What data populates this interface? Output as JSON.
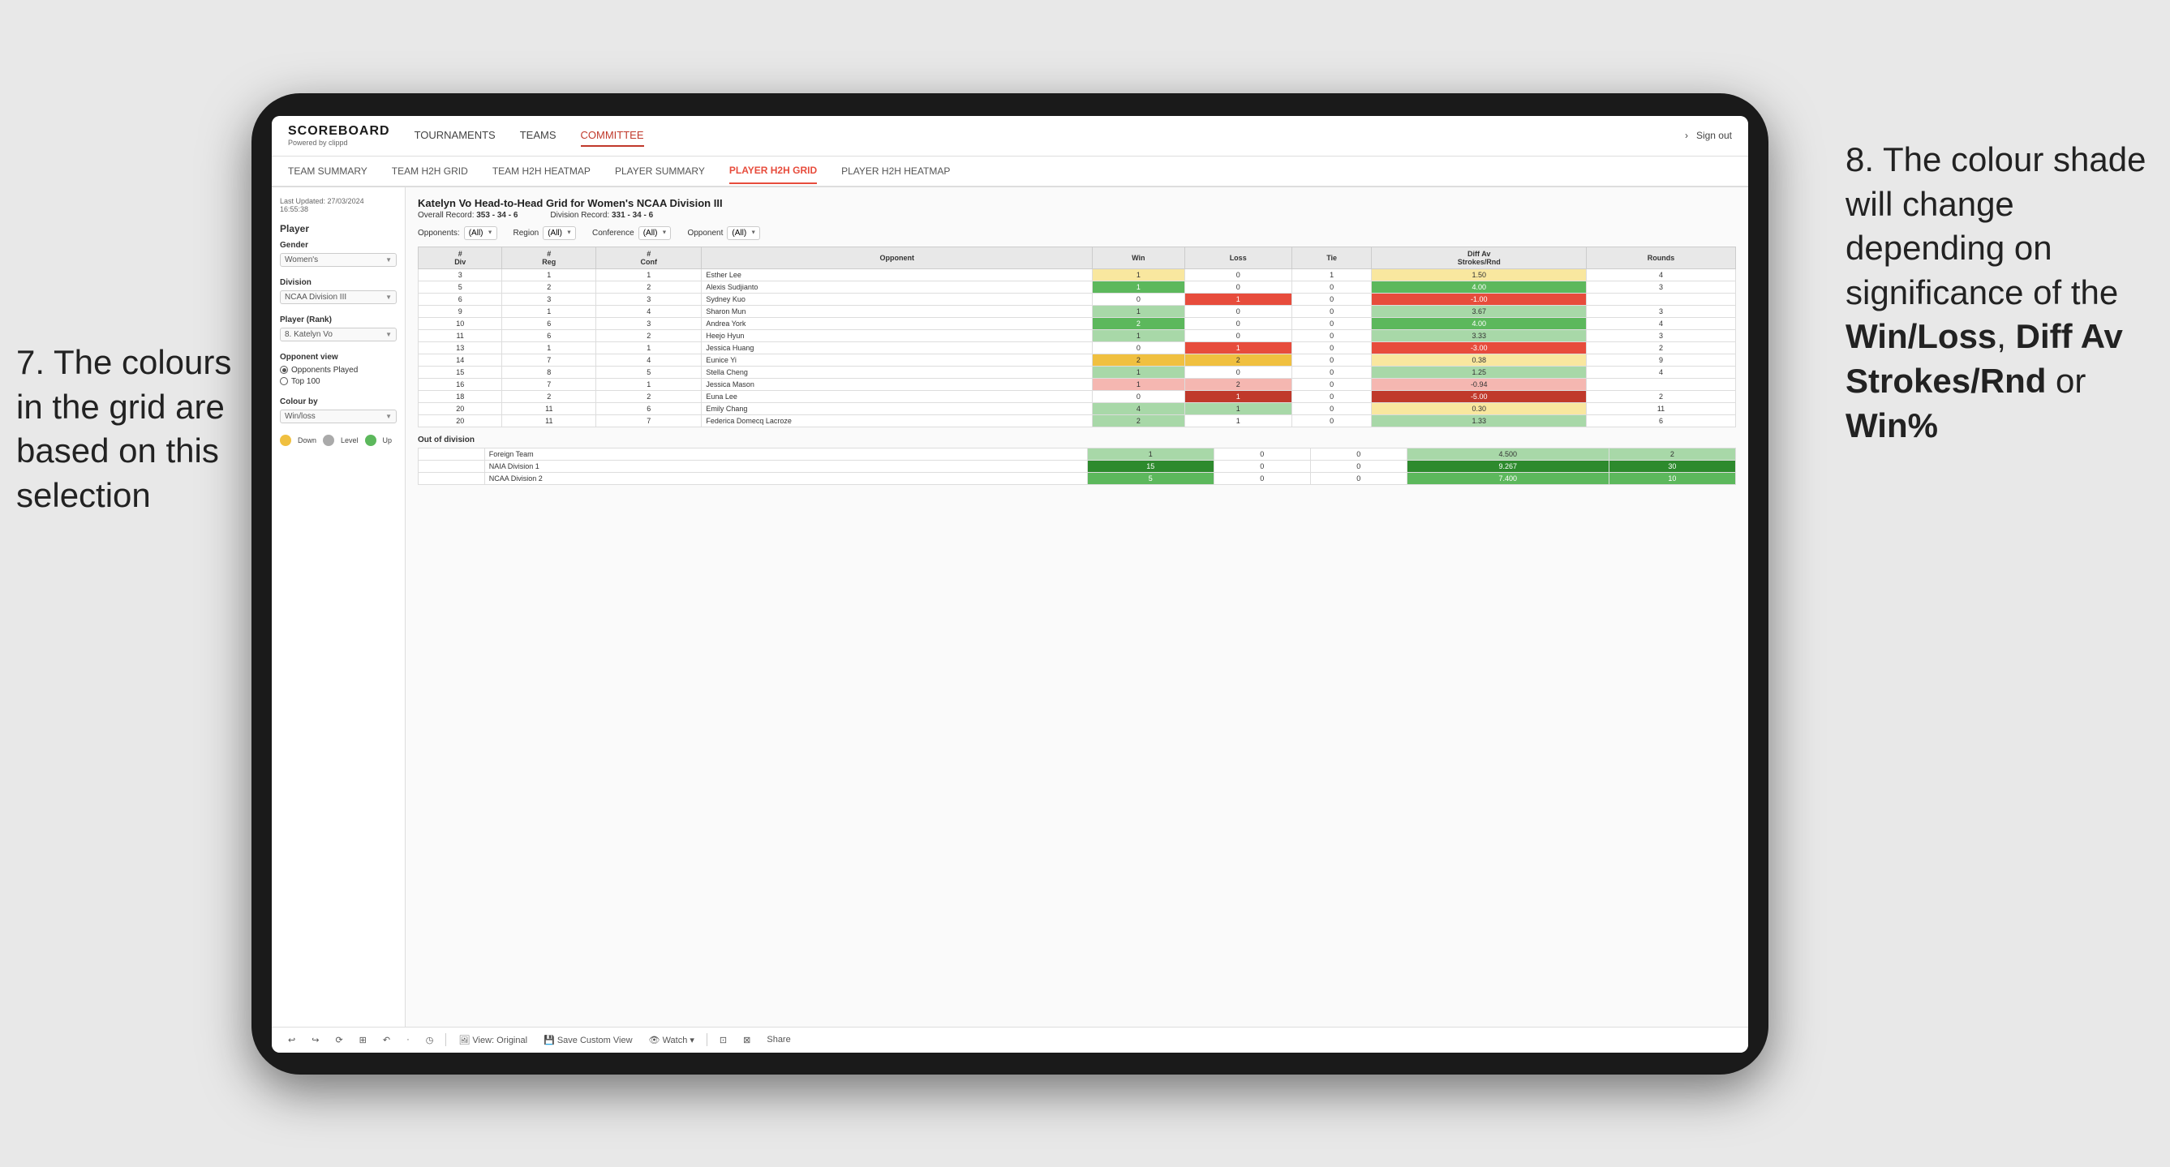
{
  "annotations": {
    "left": "7. The colours in the grid are based on this selection",
    "right_intro": "8. The colour shade will change depending on significance of the ",
    "right_bold1": "Win/Loss",
    "right_sep1": ", ",
    "right_bold2": "Diff Av Strokes/Rnd",
    "right_sep2": " or ",
    "right_bold3": "Win%"
  },
  "nav": {
    "logo": "SCOREBOARD",
    "logo_sub": "Powered by clippd",
    "items": [
      "TOURNAMENTS",
      "TEAMS",
      "COMMITTEE"
    ],
    "active": "COMMITTEE",
    "right_items": [
      "›",
      "Sign out"
    ]
  },
  "sub_nav": {
    "items": [
      "TEAM SUMMARY",
      "TEAM H2H GRID",
      "TEAM H2H HEATMAP",
      "PLAYER SUMMARY",
      "PLAYER H2H GRID",
      "PLAYER H2H HEATMAP"
    ],
    "active": "PLAYER H2H GRID"
  },
  "sidebar": {
    "last_updated_label": "Last Updated: 27/03/2024",
    "last_updated_time": "16:55:38",
    "player_section": "Player",
    "gender_label": "Gender",
    "gender_value": "Women's",
    "division_label": "Division",
    "division_value": "NCAA Division III",
    "player_rank_label": "Player (Rank)",
    "player_rank_value": "8. Katelyn Vo",
    "opponent_view_label": "Opponent view",
    "opponent_options": [
      "Opponents Played",
      "Top 100"
    ],
    "opponent_selected": "Opponents Played",
    "colour_by_label": "Colour by",
    "colour_by_value": "Win/loss",
    "legend": [
      {
        "color": "#f0c040",
        "label": "Down"
      },
      {
        "color": "#aaaaaa",
        "label": "Level"
      },
      {
        "color": "#5cb85c",
        "label": "Up"
      }
    ]
  },
  "grid": {
    "title": "Katelyn Vo Head-to-Head Grid for Women's NCAA Division III",
    "overall_record_label": "Overall Record:",
    "overall_record": "353 - 34 - 6",
    "division_record_label": "Division Record:",
    "division_record": "331 - 34 - 6",
    "filters": {
      "opponents_label": "Opponents:",
      "opponents_value": "(All)",
      "region_label": "Region",
      "region_value": "(All)",
      "conference_label": "Conference",
      "conference_value": "(All)",
      "opponent_label": "Opponent",
      "opponent_value": "(All)"
    },
    "columns": [
      "#\nDiv",
      "#\nReg",
      "#\nConf",
      "Opponent",
      "Win",
      "Loss",
      "Tie",
      "Diff Av\nStrokes/Rnd",
      "Rounds"
    ],
    "rows": [
      {
        "div": 3,
        "reg": 1,
        "conf": 1,
        "name": "Esther Lee",
        "win": 1,
        "loss": 0,
        "tie": 1,
        "diff": "1.50",
        "rounds": 4,
        "win_color": "yellow-cell",
        "loss_color": "",
        "diff_color": "yellow-cell"
      },
      {
        "div": 5,
        "reg": 2,
        "conf": 2,
        "name": "Alexis Sudjianto",
        "win": 1,
        "loss": 0,
        "tie": 0,
        "diff": "4.00",
        "rounds": 3,
        "win_color": "win-med",
        "loss_color": "",
        "diff_color": "win-med"
      },
      {
        "div": 6,
        "reg": 3,
        "conf": 3,
        "name": "Sydney Kuo",
        "win": 0,
        "loss": 1,
        "tie": 0,
        "diff": "-1.00",
        "rounds": "",
        "win_color": "",
        "loss_color": "loss-med",
        "diff_color": "loss-med"
      },
      {
        "div": 9,
        "reg": 1,
        "conf": 4,
        "name": "Sharon Mun",
        "win": 1,
        "loss": 0,
        "tie": 0,
        "diff": "3.67",
        "rounds": 3,
        "win_color": "win-light",
        "loss_color": "",
        "diff_color": "win-light"
      },
      {
        "div": 10,
        "reg": 6,
        "conf": 3,
        "name": "Andrea York",
        "win": 2,
        "loss": 0,
        "tie": 0,
        "diff": "4.00",
        "rounds": 4,
        "win_color": "win-med",
        "loss_color": "",
        "diff_color": "win-med"
      },
      {
        "div": 11,
        "reg": 6,
        "conf": 2,
        "name": "Heejo Hyun",
        "win": 1,
        "loss": 0,
        "tie": 0,
        "diff": "3.33",
        "rounds": 3,
        "win_color": "win-light",
        "loss_color": "",
        "diff_color": "win-light"
      },
      {
        "div": 13,
        "reg": 1,
        "conf": 1,
        "name": "Jessica Huang",
        "win": 0,
        "loss": 1,
        "tie": 0,
        "diff": "-3.00",
        "rounds": 2,
        "win_color": "",
        "loss_color": "loss-med",
        "diff_color": "loss-med"
      },
      {
        "div": 14,
        "reg": 7,
        "conf": 4,
        "name": "Eunice Yi",
        "win": 2,
        "loss": 2,
        "tie": 0,
        "diff": "0.38",
        "rounds": 9,
        "win_color": "yellow-dark",
        "loss_color": "yellow-dark",
        "diff_color": "yellow-cell"
      },
      {
        "div": 15,
        "reg": 8,
        "conf": 5,
        "name": "Stella Cheng",
        "win": 1,
        "loss": 0,
        "tie": 0,
        "diff": "1.25",
        "rounds": 4,
        "win_color": "win-light",
        "loss_color": "",
        "diff_color": "win-light"
      },
      {
        "div": 16,
        "reg": 7,
        "conf": 1,
        "name": "Jessica Mason",
        "win": 1,
        "loss": 2,
        "tie": 0,
        "diff": "-0.94",
        "rounds": "",
        "win_color": "loss-light",
        "loss_color": "loss-light",
        "diff_color": "loss-light"
      },
      {
        "div": 18,
        "reg": 2,
        "conf": 2,
        "name": "Euna Lee",
        "win": 0,
        "loss": 1,
        "tie": 0,
        "diff": "-5.00",
        "rounds": 2,
        "win_color": "",
        "loss_color": "loss-dark",
        "diff_color": "loss-dark"
      },
      {
        "div": 20,
        "reg": 11,
        "conf": 6,
        "name": "Emily Chang",
        "win": 4,
        "loss": 1,
        "tie": 0,
        "diff": "0.30",
        "rounds": 11,
        "win_color": "win-light",
        "loss_color": "win-light",
        "diff_color": "yellow-cell"
      },
      {
        "div": 20,
        "reg": 11,
        "conf": 7,
        "name": "Federica Domecq Lacroze",
        "win": 2,
        "loss": 1,
        "tie": 0,
        "diff": "1.33",
        "rounds": 6,
        "win_color": "win-light",
        "loss_color": "",
        "diff_color": "win-light"
      }
    ],
    "out_of_division_label": "Out of division",
    "out_of_division_rows": [
      {
        "name": "Foreign Team",
        "win": 1,
        "loss": 0,
        "tie": 0,
        "diff": "4.500",
        "rounds": 2,
        "color": "win-light"
      },
      {
        "name": "NAIA Division 1",
        "win": 15,
        "loss": 0,
        "tie": 0,
        "diff": "9.267",
        "rounds": 30,
        "color": "win-dark"
      },
      {
        "name": "NCAA Division 2",
        "win": 5,
        "loss": 0,
        "tie": 0,
        "diff": "7.400",
        "rounds": 10,
        "color": "win-med"
      }
    ]
  },
  "toolbar": {
    "buttons": [
      "↩",
      "↪",
      "⟳",
      "⊞",
      "↶",
      "·",
      "◷",
      "|",
      "View: Original",
      "Save Custom View",
      "Watch ▾",
      "⊡",
      "⊠",
      "Share"
    ]
  }
}
